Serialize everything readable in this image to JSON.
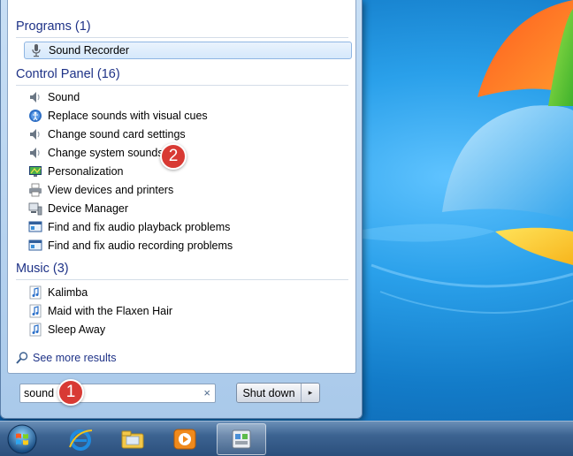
{
  "start_menu": {
    "groups": [
      {
        "header": "Programs (1)",
        "items": [
          {
            "label": "Sound Recorder",
            "icon": "microphone-icon",
            "selected": true
          }
        ]
      },
      {
        "header": "Control Panel (16)",
        "items": [
          {
            "label": "Sound",
            "icon": "speaker-icon"
          },
          {
            "label": "Replace sounds with visual cues",
            "icon": "ease-of-access-icon"
          },
          {
            "label": "Change sound card settings",
            "icon": "speaker-icon"
          },
          {
            "label": "Change system sounds",
            "icon": "speaker-icon"
          },
          {
            "label": "Personalization",
            "icon": "personalization-icon"
          },
          {
            "label": "View devices and printers",
            "icon": "printer-icon"
          },
          {
            "label": "Device Manager",
            "icon": "device-manager-icon"
          },
          {
            "label": "Find and fix audio playback problems",
            "icon": "troubleshoot-icon"
          },
          {
            "label": "Find and fix audio recording problems",
            "icon": "troubleshoot-icon"
          }
        ]
      },
      {
        "header": "Music (3)",
        "items": [
          {
            "label": "Kalimba",
            "icon": "music-note-icon"
          },
          {
            "label": "Maid with the Flaxen Hair",
            "icon": "music-note-icon"
          },
          {
            "label": "Sleep Away",
            "icon": "music-note-icon"
          }
        ]
      }
    ],
    "see_more": "See more results",
    "search": {
      "value": "sound",
      "clear_glyph": "×"
    },
    "shutdown": {
      "label": "Shut down",
      "arrow_glyph": "▸"
    }
  },
  "callouts": [
    "1",
    "2"
  ],
  "taskbar": {
    "items": [
      {
        "name": "internet-explorer-icon",
        "active": false
      },
      {
        "name": "file-explorer-icon",
        "active": false
      },
      {
        "name": "media-player-icon",
        "active": false
      },
      {
        "name": "control-panel-icon",
        "active": true
      }
    ]
  },
  "colors": {
    "accent": "#1e3287",
    "callout": "#d83a34",
    "selection": "#d5e8fb"
  }
}
